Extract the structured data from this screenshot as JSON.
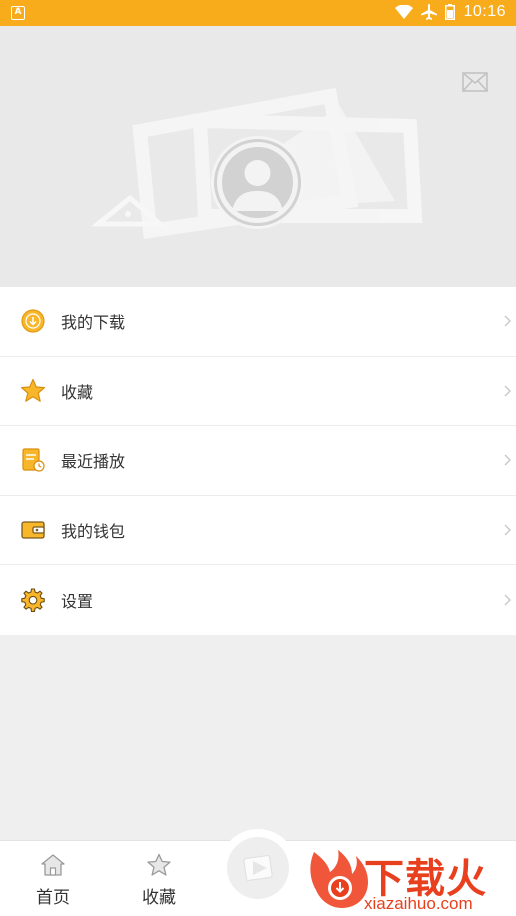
{
  "status_bar": {
    "app_icon_label": "A",
    "time": "10:16"
  },
  "menu": {
    "items": [
      {
        "label": "我的下载",
        "icon": "download-icon"
      },
      {
        "label": "收藏",
        "icon": "star-icon"
      },
      {
        "label": "最近播放",
        "icon": "recent-play-icon"
      },
      {
        "label": "我的钱包",
        "icon": "wallet-icon"
      },
      {
        "label": "设置",
        "icon": "gear-icon"
      }
    ]
  },
  "tabbar": {
    "tabs": [
      {
        "label": "首页",
        "icon": "home-icon"
      },
      {
        "label": "收藏",
        "icon": "star-icon"
      }
    ],
    "center_icon": "play-icon"
  },
  "watermark": {
    "title": "下载火",
    "url": "xiazaihuo.com"
  },
  "colors": {
    "accent": "#f8ac1c",
    "watermark": "#e8401f"
  }
}
